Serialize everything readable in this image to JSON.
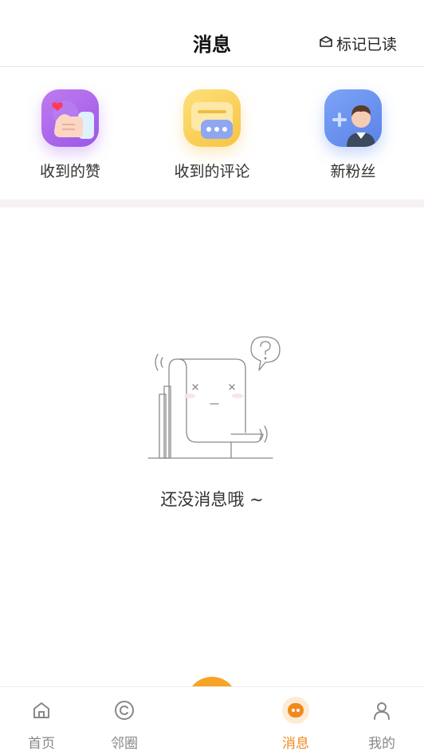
{
  "header": {
    "title": "消息",
    "mark_read_label": "标记已读"
  },
  "quick_actions": [
    {
      "label": "收到的赞",
      "icon": "thumbs-up-heart-icon"
    },
    {
      "label": "收到的评论",
      "icon": "comment-bubble-icon"
    },
    {
      "label": "新粉丝",
      "icon": "new-follower-avatar-icon"
    }
  ],
  "empty_state": {
    "text": "还没消息哦 ~",
    "icon": "empty-scroll-illustration"
  },
  "tabbar": {
    "items": [
      {
        "label": "首页",
        "icon": "home-icon",
        "active": false
      },
      {
        "label": "邻圈",
        "icon": "circle-icon",
        "active": false
      },
      {
        "label": "消息",
        "icon": "message-icon",
        "active": true
      },
      {
        "label": "我的",
        "icon": "profile-icon",
        "active": false
      }
    ]
  },
  "colors": {
    "accent": "#f08a1c",
    "fab": "#f7a325",
    "band": "#f7f2f3"
  }
}
